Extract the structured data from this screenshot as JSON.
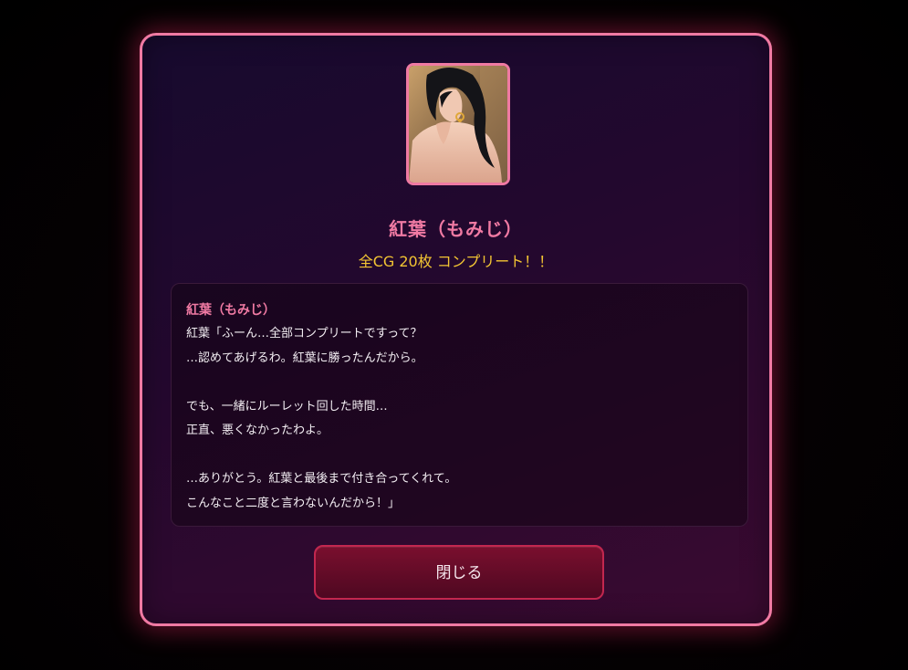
{
  "character": {
    "name": "紅葉（もみじ）",
    "complete_text": "全CG 20枚 コンプリート！！"
  },
  "message": {
    "speaker": "紅葉（もみじ）",
    "lines": [
      "紅葉「ふーん…全部コンプリートですって？",
      "…認めてあげるわ。紅葉に勝ったんだから。",
      "",
      "でも、一緒にルーレット回した時間…",
      "正直、悪くなかったわよ。",
      "",
      "…ありがとう。紅葉と最後まで付き合ってくれて。",
      "こんなこと二度と言わないんだから！」"
    ]
  },
  "buttons": {
    "close_label": "閉じる"
  },
  "colors": {
    "accent_pink": "#f07aa3",
    "gold": "#f2c433",
    "button_red": "#7a0f2e"
  }
}
